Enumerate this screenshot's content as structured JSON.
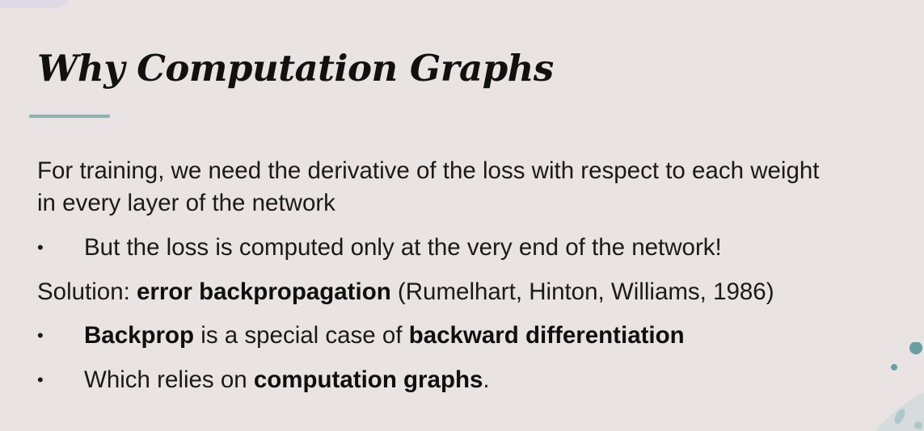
{
  "slide": {
    "title": "Why Computation Graphs",
    "para1_line1": "For training, we need the derivative of the loss with respect to each weight",
    "para1_line2": "in every layer of the network",
    "bullet1": "But the loss is computed only at the very end of the network!",
    "solution": {
      "prefix": "Solution: ",
      "bold": "error backpropagation",
      "suffix": " (Rumelhart, Hinton, Williams, 1986)"
    },
    "bullet2": {
      "bold1": "Backprop",
      "mid": " is a special case of ",
      "bold2": "backward differentiation"
    },
    "bullet3": {
      "prefix": "Which relies on ",
      "bold": "computation graphs",
      "suffix": "."
    },
    "bullet_glyph": "•"
  },
  "colors": {
    "background": "#e9e3e3",
    "accent_teal": "#8fb1b3",
    "deco_teal": "#6a9ea3"
  }
}
